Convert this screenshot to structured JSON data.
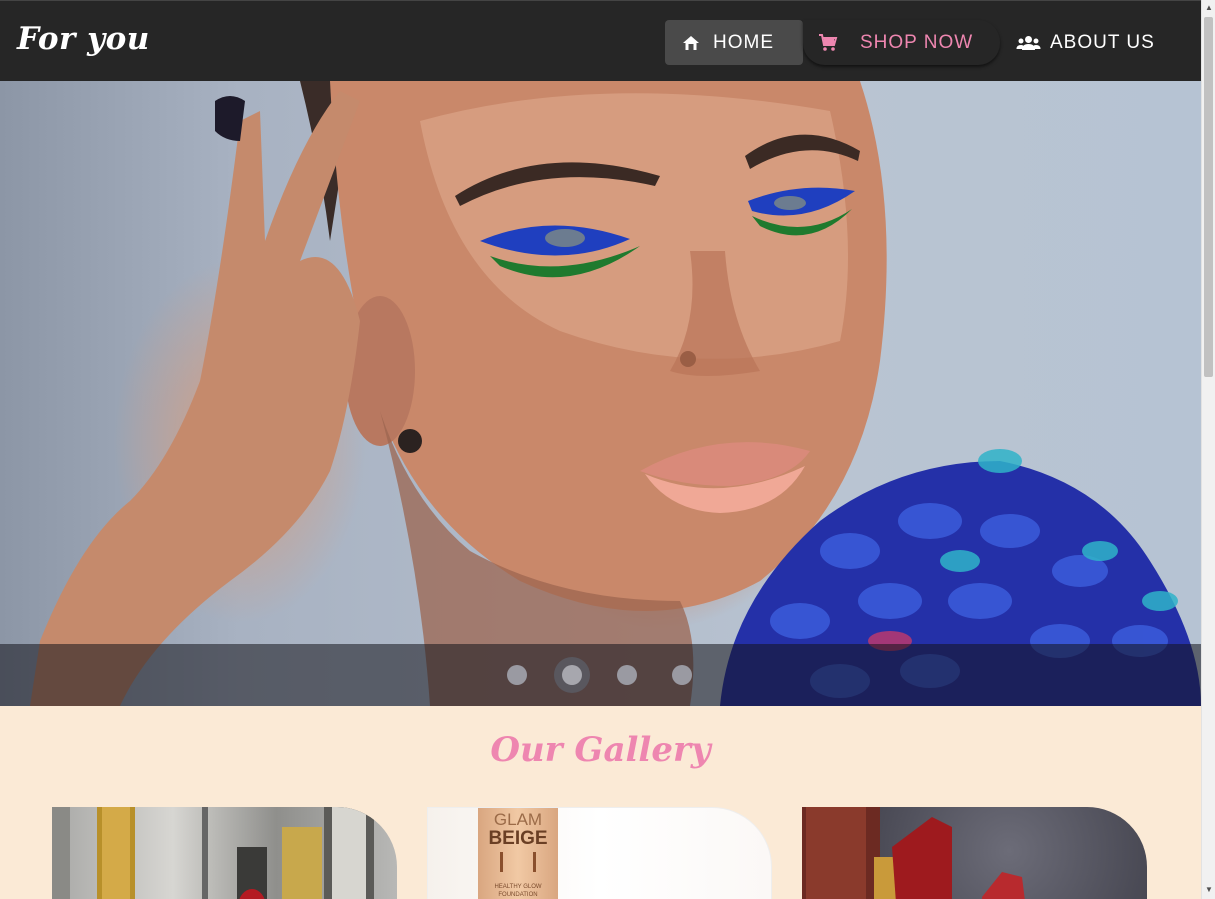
{
  "header": {
    "brand": "For you",
    "nav": [
      {
        "label": "HOME",
        "icon": "home-icon"
      },
      {
        "label": "SHOP NOW",
        "icon": "cart-icon"
      },
      {
        "label": "ABOUT US",
        "icon": "people-icon"
      }
    ]
  },
  "carousel": {
    "slides_count": 4,
    "active_index": 1
  },
  "gallery": {
    "title": "Our Gallery",
    "card2_text": [
      "GLAM",
      "BEIGE",
      "HEALTHY GLOW",
      "FOUNDATION"
    ]
  },
  "colors": {
    "navbar_bg": "#262626",
    "accent_pink": "#ee86b0",
    "page_bg": "#fbead6",
    "active_nav_bg": "#4a4a4a"
  }
}
